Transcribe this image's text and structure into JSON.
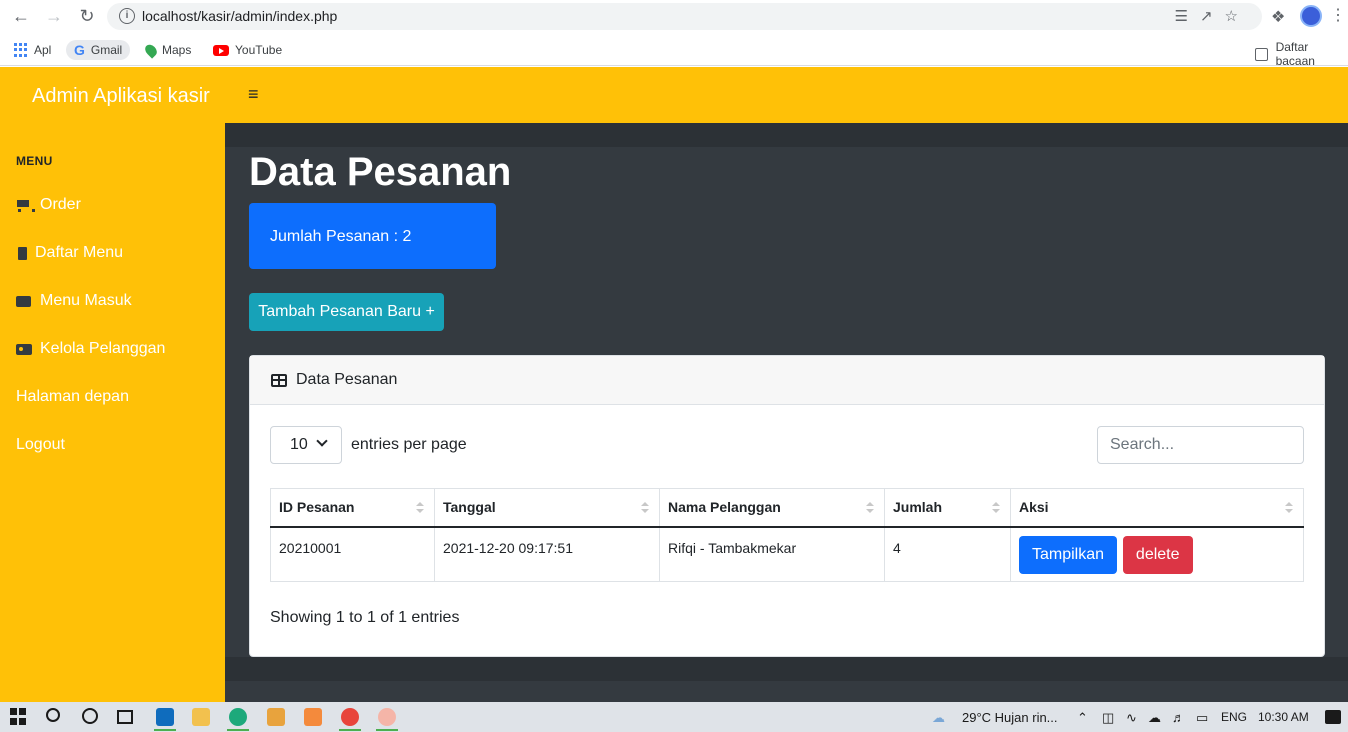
{
  "browser": {
    "url": "localhost/kasir/admin/index.php",
    "bookmarks": [
      {
        "label": "Apl"
      },
      {
        "label": "Gmail"
      },
      {
        "label": "Maps"
      },
      {
        "label": "YouTube"
      }
    ],
    "reading_list": "Daftar bacaan"
  },
  "app": {
    "brand": "Admin Aplikasi kasir",
    "accent_color": "#ffc107"
  },
  "sidebar": {
    "heading": "MENU",
    "items": [
      {
        "label": "Order",
        "icon": "cart-icon"
      },
      {
        "label": "Daftar Menu",
        "icon": "clipboard-icon"
      },
      {
        "label": "Menu Masuk",
        "icon": "box-icon"
      },
      {
        "label": "Kelola Pelanggan",
        "icon": "id-card-icon"
      },
      {
        "label": "Halaman depan"
      },
      {
        "label": "Logout"
      }
    ]
  },
  "main": {
    "title": "Data Pesanan",
    "count_label": "Jumlah Pesanan : 2",
    "add_button": "Tambah Pesanan Baru +"
  },
  "card": {
    "title": "Data Pesanan",
    "per_page_value": "10",
    "per_page_label": "entries per page",
    "search_placeholder": "Search...",
    "columns": [
      "ID Pesanan",
      "Tanggal",
      "Nama Pelanggan",
      "Jumlah",
      "Aksi"
    ],
    "rows": [
      {
        "id": "20210001",
        "tanggal": "2021-12-20 09:17:51",
        "nama": "Rifqi - Tambakmekar",
        "jumlah": "4",
        "btn_show": "Tampilkan",
        "btn_delete": "delete"
      }
    ],
    "showing": "Showing 1 to 1 of 1 entries"
  },
  "taskbar": {
    "weather": "29°C  Hujan rin...",
    "language": "ENG",
    "time": "10:30 AM"
  }
}
